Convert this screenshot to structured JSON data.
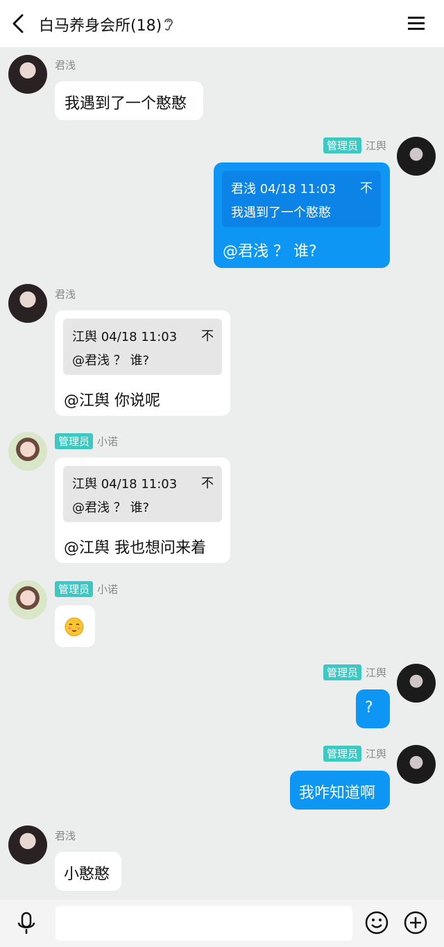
{
  "header": {
    "title": "白马养身会所(18)"
  },
  "messages": [
    {
      "sender": "君浅",
      "text": "我遇到了一个憨憨"
    },
    {
      "sender": "江舆",
      "badge": "管理员",
      "quote": {
        "head": "君浅 04/18 11:03",
        "body": "我遇到了一个憨憨",
        "top_glyph": "不"
      },
      "text": "@君浅 ？ 谁?"
    },
    {
      "sender": "君浅",
      "quote": {
        "head": "江舆 04/18 11:03",
        "body": "@君浅 ？ 谁?",
        "top_glyph": "不"
      },
      "text": "@江舆 你说呢"
    },
    {
      "sender": "小诺",
      "badge": "管理员",
      "quote": {
        "head": "江舆 04/18 11:03",
        "body": "@君浅 ？ 谁?",
        "top_glyph": "不"
      },
      "text": "@江舆 我也想问来着"
    },
    {
      "sender": "小诺",
      "badge": "管理员",
      "emoji": "smiling-emoji"
    },
    {
      "sender": "江舆",
      "badge": "管理员",
      "text": "?"
    },
    {
      "sender": "江舆",
      "badge": "管理员",
      "text": "我咋知道啊"
    },
    {
      "sender": "君浅",
      "text": "小憨憨"
    }
  ],
  "input": {
    "placeholder": ""
  },
  "colors": {
    "background": "#ebeeec",
    "my_bubble": "#0e96f5",
    "badge": "#3ec8c4"
  },
  "icons": [
    "back-arrow-icon",
    "ear-icon",
    "menu-icon",
    "microphone-icon",
    "emoji-icon",
    "plus-circle-icon"
  ]
}
